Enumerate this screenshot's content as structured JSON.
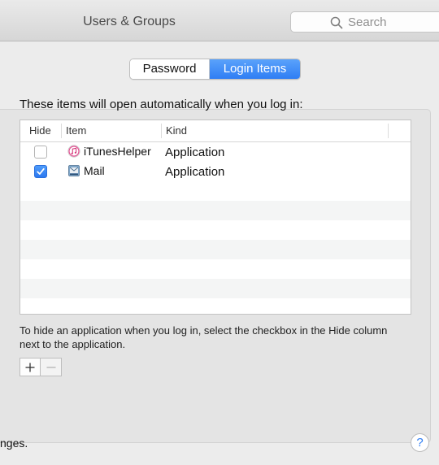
{
  "window": {
    "title": "Users & Groups"
  },
  "search": {
    "placeholder": "Search",
    "icon": "magnifying-glass"
  },
  "tabs": [
    {
      "label": "Password",
      "selected": false
    },
    {
      "label": "Login Items",
      "selected": true
    }
  ],
  "colors": {
    "accent": "#2f7ef4",
    "checkbox_checked": "#3b8af7"
  },
  "login_items": {
    "heading": "These items will open automatically when you log in:",
    "columns": {
      "hide": "Hide",
      "item": "Item",
      "kind": "Kind"
    },
    "rows": [
      {
        "hide": false,
        "icon": "itunes-icon",
        "name": "iTunesHelper",
        "kind": "Application"
      },
      {
        "hide": true,
        "icon": "mail-icon",
        "name": "Mail",
        "kind": "Application"
      }
    ],
    "hint": "To hide an application when you log in, select the checkbox in the Hide column next to the application."
  },
  "controls": {
    "add_symbol": "+",
    "remove_symbol": "−"
  },
  "footer": {
    "text": "nges.",
    "help_label": "?"
  }
}
